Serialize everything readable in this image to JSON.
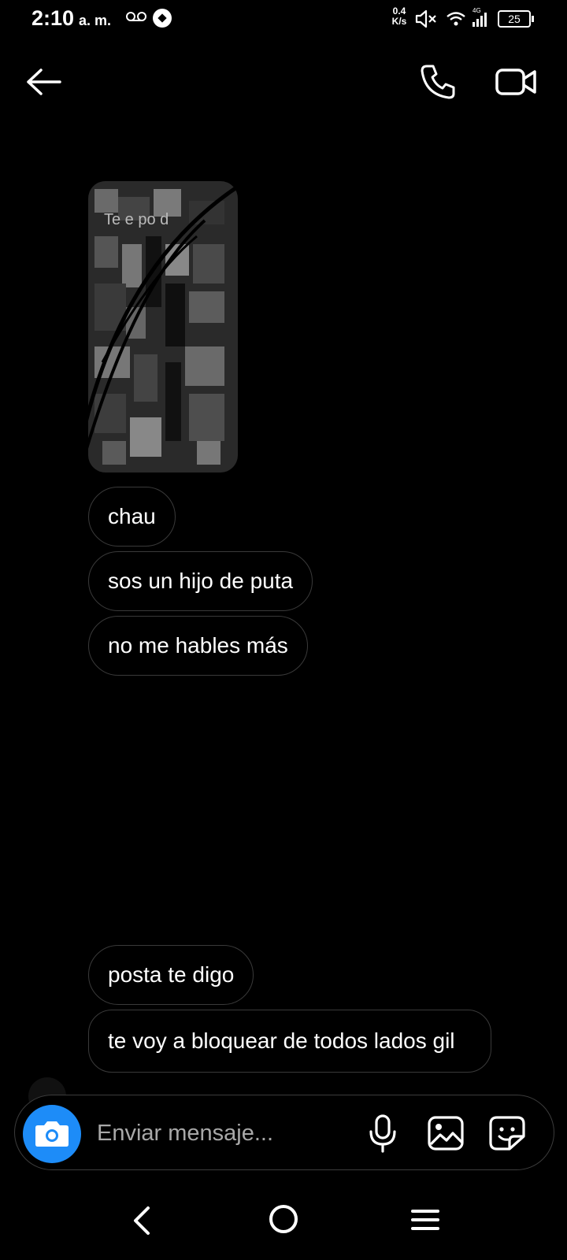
{
  "status_bar": {
    "time": "2:10",
    "ampm": "a. m.",
    "speed_value": "0.4",
    "speed_unit": "K/s",
    "network": "4G",
    "battery": "25"
  },
  "header": {
    "back_icon": "arrow-left-icon",
    "call_icon": "phone-icon",
    "video_icon": "video-camera-icon"
  },
  "shared_media": {
    "caption": "Te e po d"
  },
  "messages": [
    {
      "text": "chau"
    },
    {
      "text": "sos un hijo de puta"
    },
    {
      "text": "no me hables más"
    },
    {
      "text": "posta te digo"
    },
    {
      "text": "te voy a bloquear de todos lados gil"
    }
  ],
  "composer": {
    "placeholder": "Enviar mensaje...",
    "camera_icon": "camera-icon",
    "mic_icon": "microphone-icon",
    "gallery_icon": "image-icon",
    "sticker_icon": "sticker-icon",
    "accent": "#1d8cf8"
  },
  "nav": {
    "back_icon": "nav-back-icon",
    "home_icon": "nav-home-icon",
    "menu_icon": "nav-recent-icon"
  }
}
